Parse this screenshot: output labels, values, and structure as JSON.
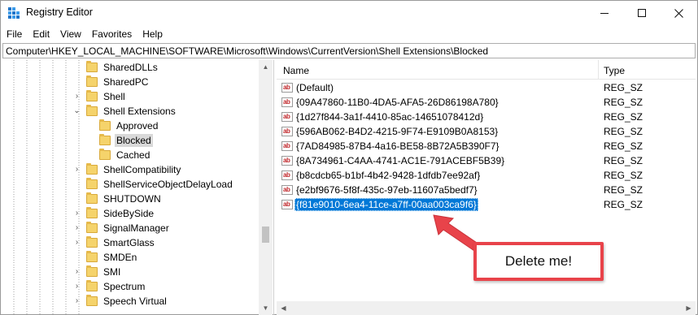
{
  "window": {
    "title": "Registry Editor"
  },
  "menu": [
    "File",
    "Edit",
    "View",
    "Favorites",
    "Help"
  ],
  "address": "Computer\\HKEY_LOCAL_MACHINE\\SOFTWARE\\Microsoft\\Windows\\CurrentVersion\\Shell Extensions\\Blocked",
  "tree": {
    "items": [
      {
        "label": "SharedDLLs",
        "expander": ""
      },
      {
        "label": "SharedPC",
        "expander": ""
      },
      {
        "label": "Shell",
        "expander": ">"
      },
      {
        "label": "Shell Extensions",
        "expander": "v"
      },
      {
        "label": "Approved",
        "expander": ""
      },
      {
        "label": "Blocked",
        "expander": ""
      },
      {
        "label": "Cached",
        "expander": ""
      },
      {
        "label": "ShellCompatibility",
        "expander": ">"
      },
      {
        "label": "ShellServiceObjectDelayLoad",
        "expander": ""
      },
      {
        "label": "SHUTDOWN",
        "expander": ""
      },
      {
        "label": "SideBySide",
        "expander": ">"
      },
      {
        "label": "SignalManager",
        "expander": ">"
      },
      {
        "label": "SmartGlass",
        "expander": ">"
      },
      {
        "label": "SMDEn",
        "expander": ""
      },
      {
        "label": "SMI",
        "expander": ">"
      },
      {
        "label": "Spectrum",
        "expander": ">"
      },
      {
        "label": "Speech Virtual",
        "expander": ">"
      }
    ],
    "selected": "Blocked"
  },
  "values": {
    "columns": {
      "name": "Name",
      "type": "Type"
    },
    "rows": [
      {
        "name": "(Default)",
        "type": "REG_SZ",
        "icon": "string-value-icon"
      },
      {
        "name": "{09A47860-11B0-4DA5-AFA5-26D86198A780}",
        "type": "REG_SZ",
        "icon": "string-value-icon"
      },
      {
        "name": "{1d27f844-3a1f-4410-85ac-14651078412d}",
        "type": "REG_SZ",
        "icon": "string-value-icon"
      },
      {
        "name": "{596AB062-B4D2-4215-9F74-E9109B0A8153}",
        "type": "REG_SZ",
        "icon": "string-value-icon"
      },
      {
        "name": "{7AD84985-87B4-4a16-BE58-8B72A5B390F7}",
        "type": "REG_SZ",
        "icon": "string-value-icon"
      },
      {
        "name": "{8A734961-C4AA-4741-AC1E-791ACEBF5B39}",
        "type": "REG_SZ",
        "icon": "string-value-icon"
      },
      {
        "name": "{b8cdcb65-b1bf-4b42-9428-1dfdb7ee92af}",
        "type": "REG_SZ",
        "icon": "string-value-icon"
      },
      {
        "name": "{e2bf9676-5f8f-435c-97eb-11607a5bedf7}",
        "type": "REG_SZ",
        "icon": "string-value-icon"
      },
      {
        "name": "{f81e9010-6ea4-11ce-a7ff-00aa003ca9f6}",
        "type": "REG_SZ",
        "icon": "string-value-icon"
      }
    ],
    "selected_index": 8
  },
  "annotation": {
    "text": "Delete me!",
    "color": "#e8434a"
  },
  "colors": {
    "selection": "#0078d7",
    "folder": "#f5d36b"
  }
}
